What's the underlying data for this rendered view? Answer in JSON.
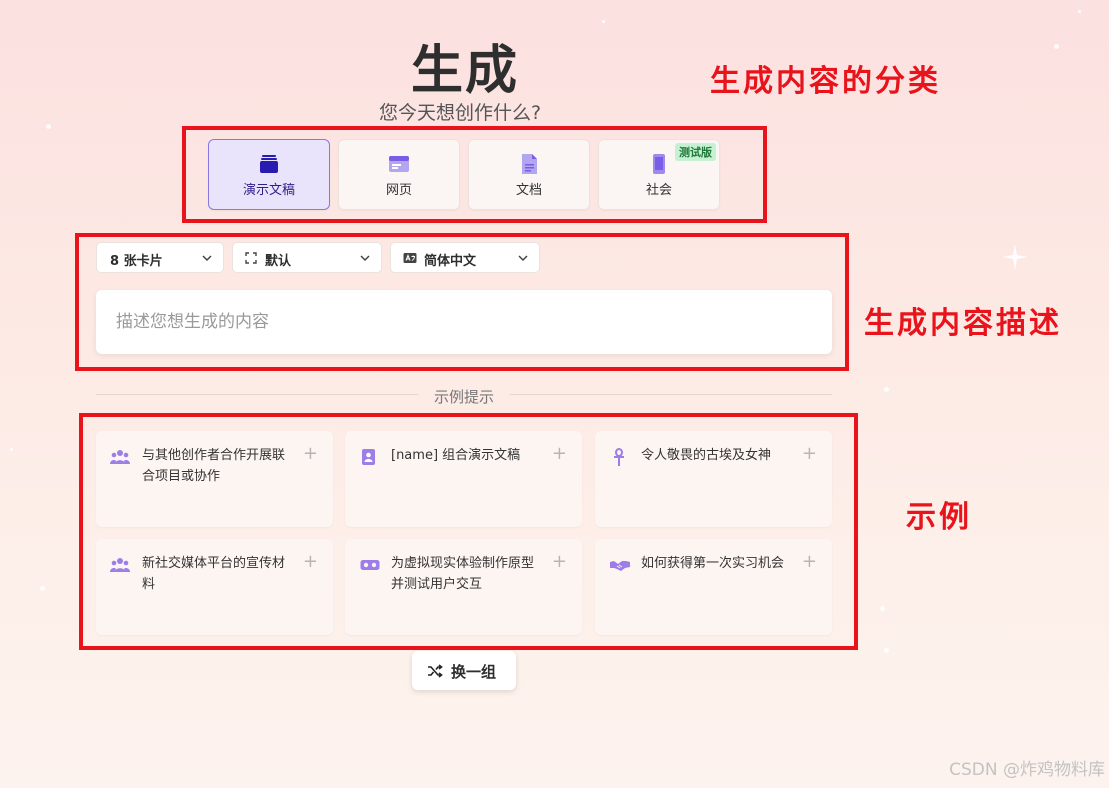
{
  "page": {
    "title": "生成",
    "subtitle": "您今天想创作什么?"
  },
  "categories": [
    {
      "label": "演示文稿",
      "icon": "presentation-icon",
      "active": true
    },
    {
      "label": "网页",
      "icon": "webpage-icon",
      "active": false
    },
    {
      "label": "文档",
      "icon": "document-icon",
      "active": false
    },
    {
      "label": "社会",
      "icon": "phone-icon",
      "active": false,
      "badge": "测试版"
    }
  ],
  "options": {
    "cards": "8 张卡片",
    "layout": "默认",
    "language": "简体中文"
  },
  "prompt": {
    "placeholder": "描述您想生成的内容",
    "value": ""
  },
  "examples_section": {
    "label": "示例提示",
    "items": [
      {
        "icon": "people-icon",
        "text": "与其他创作者合作开展联合项目或协作"
      },
      {
        "icon": "contact-card-icon",
        "text": "[name] 组合演示文稿"
      },
      {
        "icon": "ankh-icon",
        "text": "令人敬畏的古埃及女神"
      },
      {
        "icon": "people-icon",
        "text": "新社交媒体平台的宣传材料"
      },
      {
        "icon": "vr-headset-icon",
        "text": "为虚拟现实体验制作原型并测试用户交互"
      },
      {
        "icon": "handshake-icon",
        "text": "如何获得第一次实习机会"
      }
    ]
  },
  "shuffle": {
    "label": "换一组"
  },
  "annotations": {
    "categories": "生成内容的分类",
    "description": "生成内容描述",
    "examples": "示例"
  },
  "watermark": "CSDN @炸鸡物料库",
  "colors": {
    "annotation": "#e8131b",
    "accent": "#7b5ce6",
    "active_bg": "#e9e4fb"
  }
}
